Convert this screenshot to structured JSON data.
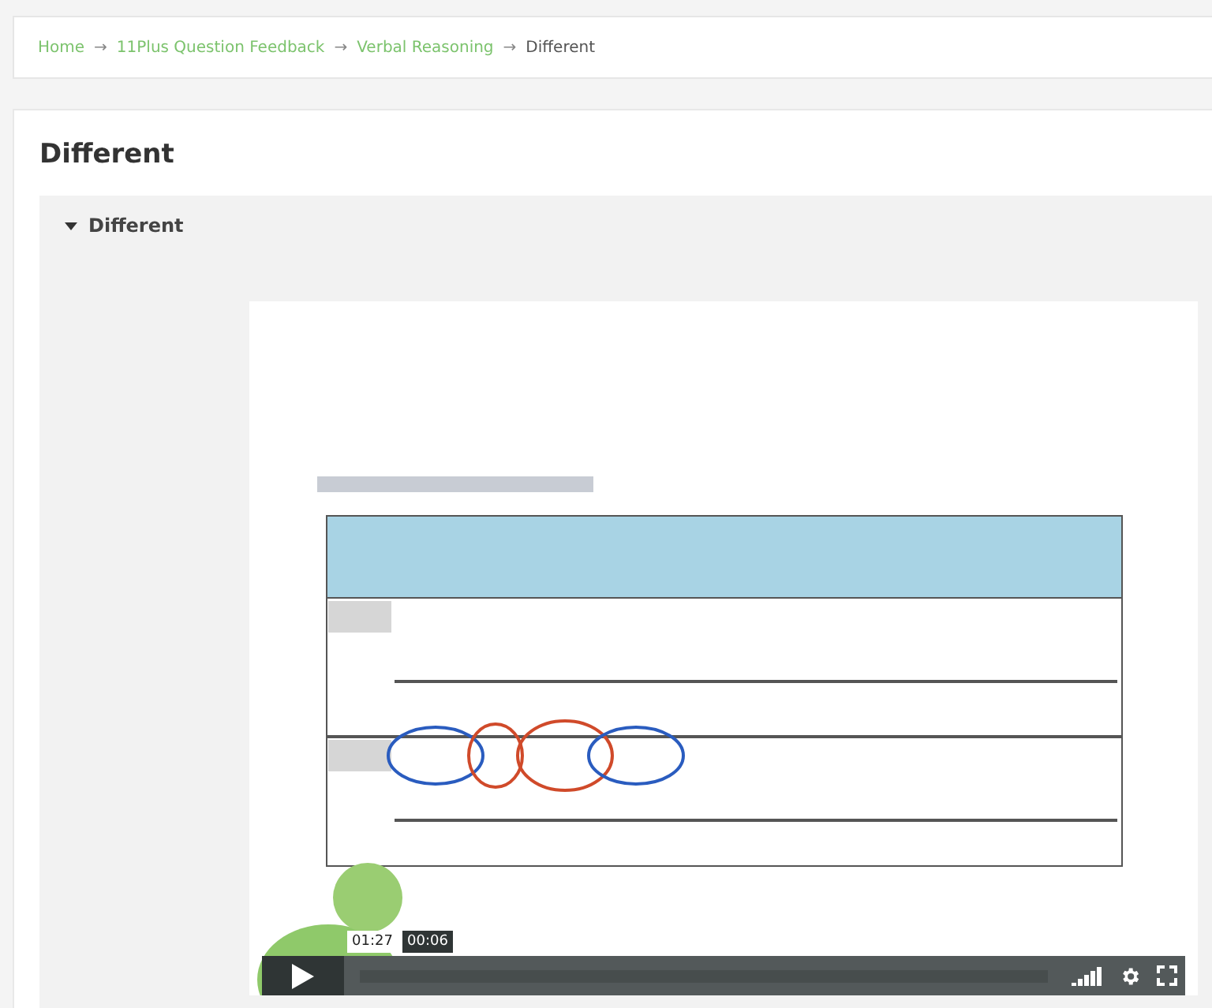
{
  "breadcrumb": [
    {
      "label": "Home",
      "kind": "link"
    },
    {
      "label": "11Plus Question Feedback",
      "kind": "link"
    },
    {
      "label": "Verbal Reasoning",
      "kind": "link"
    },
    {
      "label": "Different",
      "kind": "current"
    }
  ],
  "separator": "→",
  "title": "Different",
  "section": {
    "label": "Different",
    "expanded": true
  },
  "video": {
    "kind": "picture",
    "hover_time": "01:27",
    "current_time": "00:06"
  }
}
